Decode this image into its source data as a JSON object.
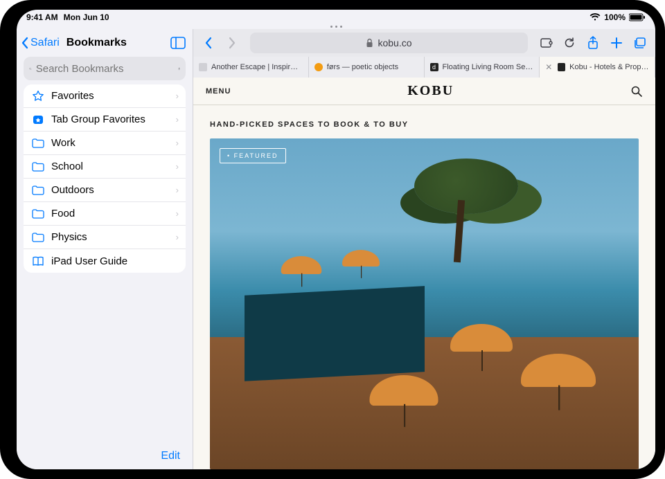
{
  "status": {
    "time": "9:41 AM",
    "date": "Mon Jun 10",
    "battery": "100%"
  },
  "sidebar": {
    "back_label": "Safari",
    "title": "Bookmarks",
    "search_placeholder": "Search Bookmarks",
    "items": [
      {
        "label": "Favorites",
        "icon": "star",
        "chevron": true
      },
      {
        "label": "Tab Group Favorites",
        "icon": "tabstar",
        "chevron": true
      },
      {
        "label": "Work",
        "icon": "folder",
        "chevron": true
      },
      {
        "label": "School",
        "icon": "folder",
        "chevron": true
      },
      {
        "label": "Outdoors",
        "icon": "folder",
        "chevron": true
      },
      {
        "label": "Food",
        "icon": "folder",
        "chevron": true
      },
      {
        "label": "Physics",
        "icon": "folder",
        "chevron": true
      },
      {
        "label": "iPad User Guide",
        "icon": "book",
        "chevron": false
      }
    ],
    "edit_label": "Edit"
  },
  "browser": {
    "address": "kobu.co",
    "tabs": [
      {
        "label": "Another Escape | Inspir…",
        "type": "gray"
      },
      {
        "label": "førs — poetic objects",
        "type": "orange"
      },
      {
        "label": "Floating Living Room Se…",
        "type": "dark",
        "glyph": "d"
      },
      {
        "label": "Kobu - Hotels & Propert…",
        "type": "dark",
        "glyph": "≡",
        "active": true
      }
    ]
  },
  "page": {
    "menu_label": "MENU",
    "brand": "KOBU",
    "tagline": "HAND-PICKED SPACES TO BOOK & TO BUY",
    "featured_label": "FEATURED"
  }
}
